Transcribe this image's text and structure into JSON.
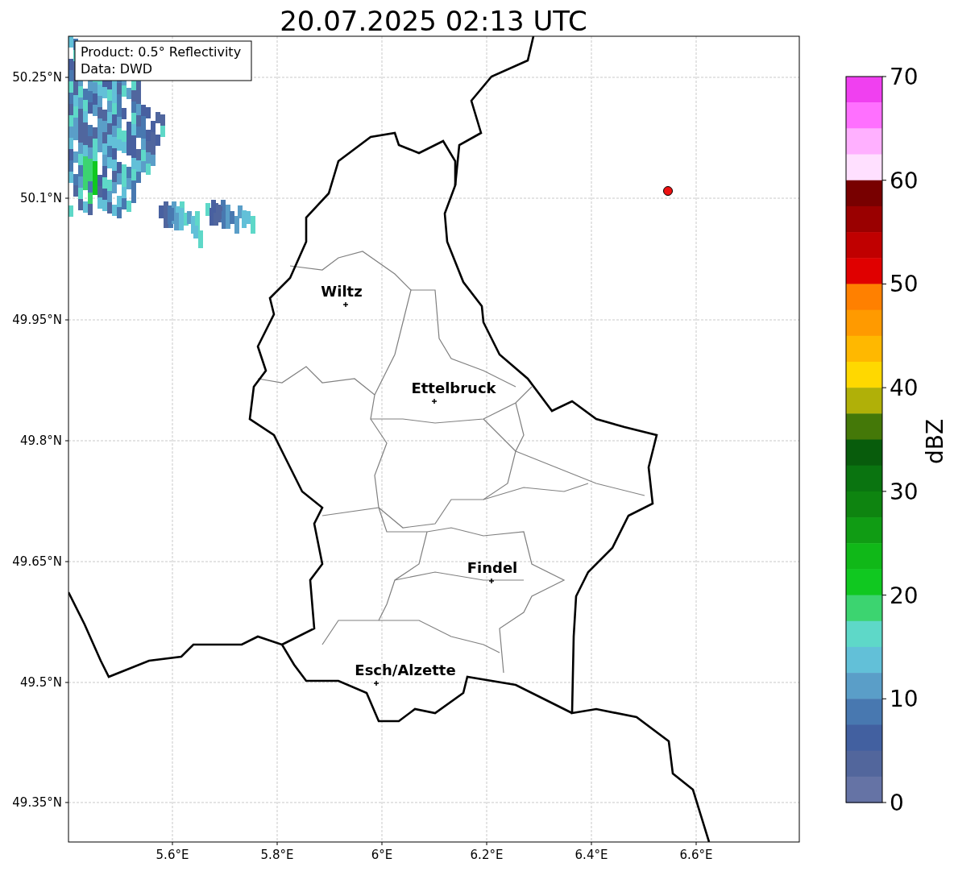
{
  "title": "20.07.2025 02:13 UTC",
  "info_box": {
    "lines": [
      "Product: 0.5° Reflectivity",
      "Data: DWD"
    ]
  },
  "x_ticks": [
    "5.6°E",
    "5.8°E",
    "6°E",
    "6.2°E",
    "6.4°E",
    "6.6°E"
  ],
  "y_ticks": [
    "50.25°N",
    "50.1°N",
    "49.95°N",
    "49.8°N",
    "49.65°N",
    "49.5°N",
    "49.35°N"
  ],
  "cities": [
    {
      "name": "Wiltz"
    },
    {
      "name": "Ettelbruck"
    },
    {
      "name": "Findel"
    },
    {
      "name": "Esch/Alzette"
    }
  ],
  "colorbar": {
    "label": "dBZ",
    "ticks": [
      "70",
      "60",
      "50",
      "40",
      "30",
      "20",
      "10",
      "0"
    ],
    "bands": [
      {
        "color": "#f040f0"
      },
      {
        "color": "#ff70ff"
      },
      {
        "color": "#ffb0ff"
      },
      {
        "color": "#ffe0ff"
      },
      {
        "color": "#780000"
      },
      {
        "color": "#9a0000"
      },
      {
        "color": "#c00000"
      },
      {
        "color": "#e00000"
      },
      {
        "color": "#ff8000"
      },
      {
        "color": "#ff9a00"
      },
      {
        "color": "#ffb800"
      },
      {
        "color": "#ffd800"
      },
      {
        "color": "#b0b008"
      },
      {
        "color": "#447808"
      },
      {
        "color": "#085c0c"
      },
      {
        "color": "#0a7410"
      },
      {
        "color": "#0e8410"
      },
      {
        "color": "#109c14"
      },
      {
        "color": "#10b818"
      },
      {
        "color": "#10c820"
      },
      {
        "color": "#3cd470"
      },
      {
        "color": "#5ed8c8"
      },
      {
        "color": "#62c0d8"
      },
      {
        "color": "#5a9ec8"
      },
      {
        "color": "#4878b0"
      },
      {
        "color": "#4260a0"
      },
      {
        "color": "#52669c"
      },
      {
        "color": "#6573a5"
      }
    ]
  }
}
